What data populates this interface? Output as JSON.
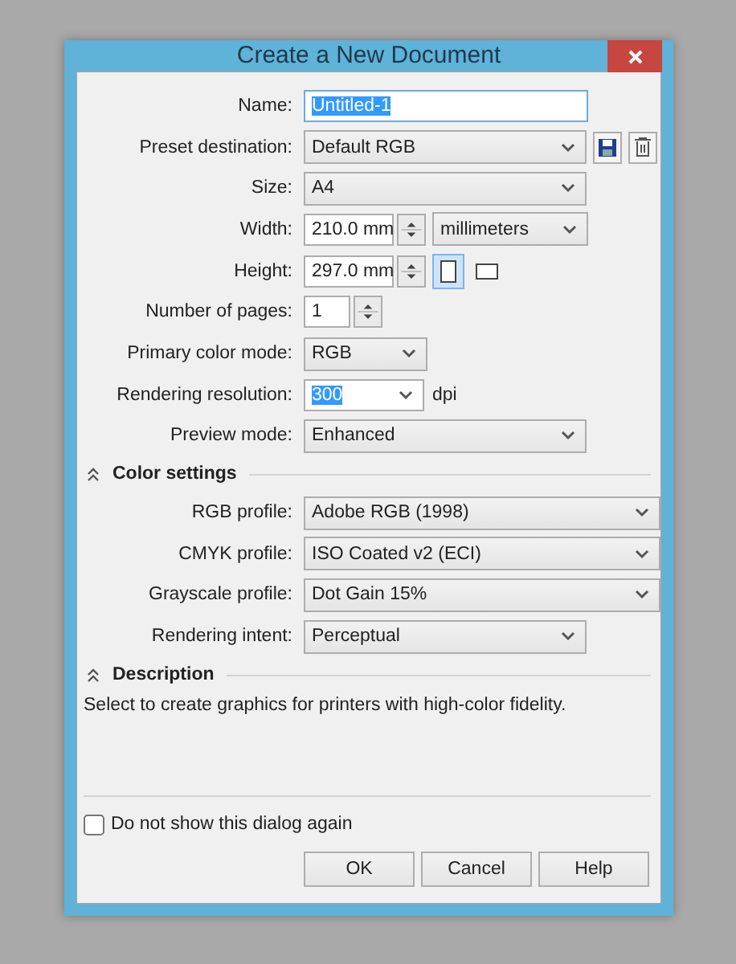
{
  "window": {
    "title": "Create a New Document"
  },
  "fields": [
    {
      "label": "Name:",
      "kind": "text",
      "value": "Untitled-1",
      "highlighted": true
    },
    {
      "label": "Preset destination:",
      "kind": "preset",
      "value": "Default RGB"
    },
    {
      "label": "Size:",
      "kind": "dropdown",
      "value": "A4"
    },
    {
      "label": "Width:",
      "kind": "spin_units",
      "value": "210.0 mm",
      "unit": "millimeters"
    },
    {
      "label": "Height:",
      "kind": "spin_orientation",
      "value": "297.0 mm",
      "orientations": [
        {
          "kind": "portrait",
          "selected": true
        },
        {
          "kind": "landscape",
          "selected": false
        }
      ]
    },
    {
      "label": "Number of pages:",
      "kind": "spin",
      "value": "1"
    },
    {
      "label": "Primary color mode:",
      "kind": "short_dropdown",
      "value": "RGB"
    },
    {
      "label": "Rendering resolution:",
      "kind": "combo",
      "value": "300",
      "highlighted": true,
      "unit": "dpi"
    },
    {
      "label": "Preview mode:",
      "kind": "dropdown",
      "value": "Enhanced"
    }
  ],
  "color_settings": {
    "title": "Color settings",
    "expanded": true,
    "fields": [
      {
        "label": "RGB profile:",
        "kind": "wide_dropdown",
        "value": "Adobe RGB (1998)"
      },
      {
        "label": "CMYK profile:",
        "kind": "wide_dropdown",
        "value": "ISO Coated v2 (ECI)"
      },
      {
        "label": "Grayscale profile:",
        "kind": "wide_dropdown",
        "value": "Dot Gain 15%"
      },
      {
        "label": "Rendering intent:",
        "kind": "dropdown",
        "value": "Perceptual"
      }
    ]
  },
  "description": {
    "title": "Description",
    "expanded": true,
    "text": "Select to create graphics for printers with high-color fidelity."
  },
  "dont_show_again": {
    "label": "Do not show this dialog again",
    "checked": false
  },
  "buttons": [
    "OK",
    "Cancel",
    "Help"
  ]
}
